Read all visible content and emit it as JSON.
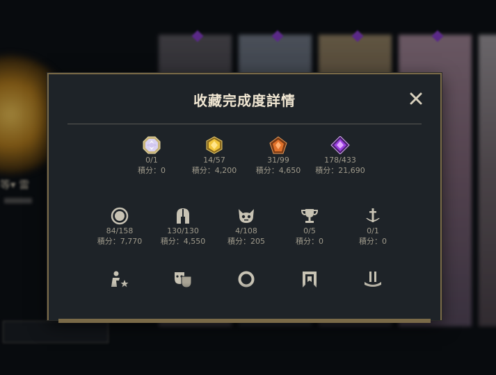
{
  "background": {
    "profile_text": "等▾ 雷"
  },
  "modal": {
    "title": "收藏完成度詳情",
    "close_icon": "close-icon",
    "row1": [
      {
        "icon": "gem-white-octagon-icon",
        "count": "0/1",
        "score": "積分：0"
      },
      {
        "icon": "gem-gold-hexagon-icon",
        "count": "14/57",
        "score": "積分：4,200"
      },
      {
        "icon": "gem-orange-pentagon-icon",
        "count": "31/99",
        "score": "積分：4,650"
      },
      {
        "icon": "gem-purple-diamond-icon",
        "count": "178/433",
        "score": "積分：21,690"
      }
    ],
    "row2": [
      {
        "icon": "ring-icon",
        "count": "84/158",
        "score": "積分：7,770"
      },
      {
        "icon": "helmet-icon",
        "count": "130/130",
        "score": "積分：4,550"
      },
      {
        "icon": "poro-icon",
        "count": "4/108",
        "score": "積分：205"
      },
      {
        "icon": "trophy-icon",
        "count": "0/5",
        "score": "積分：0"
      },
      {
        "icon": "ward-icon",
        "count": "0/1",
        "score": "積分：0"
      }
    ],
    "row3_icons": [
      "emote-figure-icon",
      "theater-masks-icon",
      "circle-frame-icon",
      "banner-icon",
      "crown-base-icon"
    ]
  },
  "colors": {
    "accent_gold": "#7a6a48",
    "title_text": "#f0e6d2",
    "body_text": "#a09b8c",
    "panel_bg": "#1e2328"
  }
}
